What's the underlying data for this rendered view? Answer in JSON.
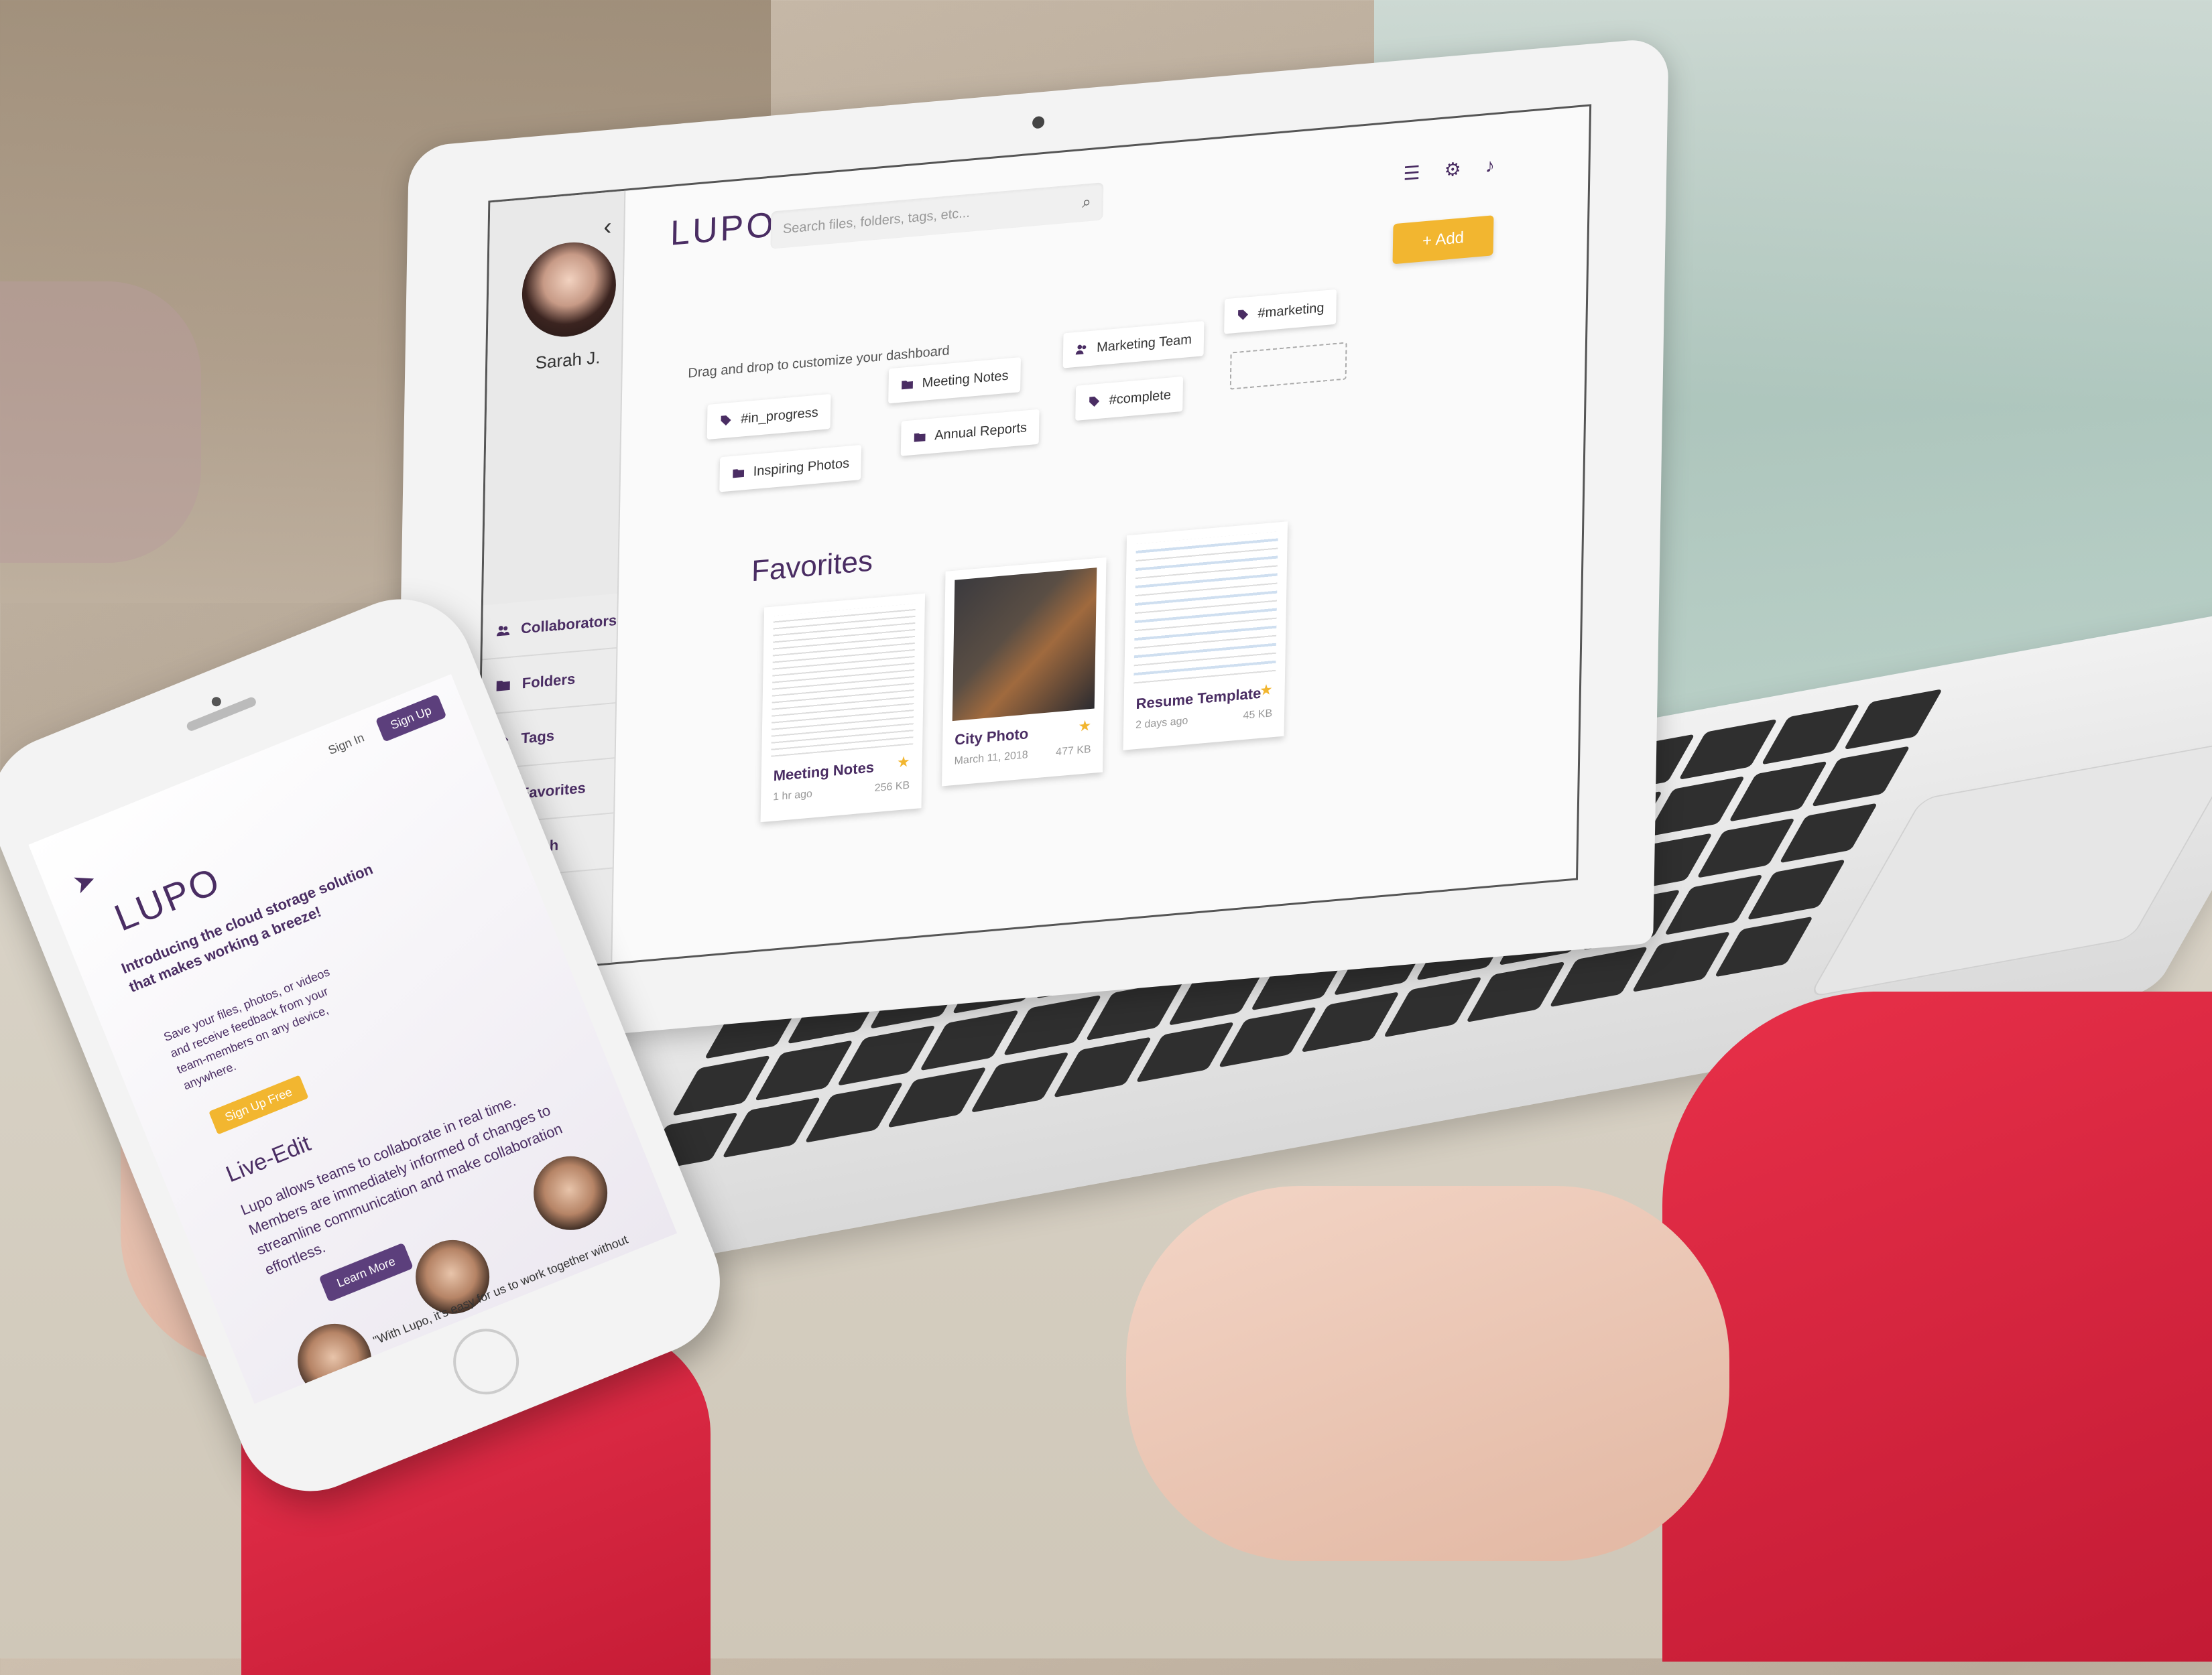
{
  "laptop": {
    "logo": "LUPO",
    "search_placeholder": "Search files, folders, tags, etc...",
    "add_label": "+ Add",
    "user_name": "Sarah J.",
    "hint": "Drag and drop to customize your dashboard",
    "nav": [
      {
        "label": "Collaborators",
        "icon": "users-icon"
      },
      {
        "label": "Folders",
        "icon": "folder-icon"
      },
      {
        "label": "Tags",
        "icon": "tag-icon"
      },
      {
        "label": "Favorites",
        "icon": "star-icon"
      },
      {
        "label": "Trash",
        "icon": "trash-icon"
      }
    ],
    "chips": [
      {
        "label": "#in_progress",
        "icon": "tag-icon"
      },
      {
        "label": "Meeting Notes",
        "icon": "folder-icon"
      },
      {
        "label": "Marketing Team",
        "icon": "users-icon"
      },
      {
        "label": "#marketing",
        "icon": "tag-icon"
      },
      {
        "label": "Inspiring Photos",
        "icon": "folder-icon"
      },
      {
        "label": "Annual Reports",
        "icon": "folder-icon"
      },
      {
        "label": "#complete",
        "icon": "tag-icon"
      }
    ],
    "favorites_title": "Favorites",
    "favorites": [
      {
        "name": "Meeting Notes",
        "meta": "1 hr ago",
        "size": "256 KB"
      },
      {
        "name": "City Photo",
        "meta": "March 11, 2018",
        "size": "477 KB"
      },
      {
        "name": "Resume Template",
        "meta": "2 days ago",
        "size": "45 KB"
      }
    ],
    "accent": "#4a2d63",
    "button_color": "#f2b630"
  },
  "phone": {
    "sign_in": "Sign In",
    "sign_up": "Sign Up",
    "logo": "LUPO",
    "intro": "Introducing the cloud storage solution that makes working a breeze!",
    "save_text": "Save your files, photos, or videos and receive feedback from your team-members on any device, anywhere.",
    "sign_up_free": "Sign Up Free",
    "live_edit_title": "Live-Edit",
    "live_edit_text": "Lupo allows teams to collaborate in real time. Members are immediately informed of changes to streamline communication and make collaboration effortless.",
    "learn_more": "Learn More",
    "quote": "\"With Lupo, it's easy for us to work together without"
  }
}
